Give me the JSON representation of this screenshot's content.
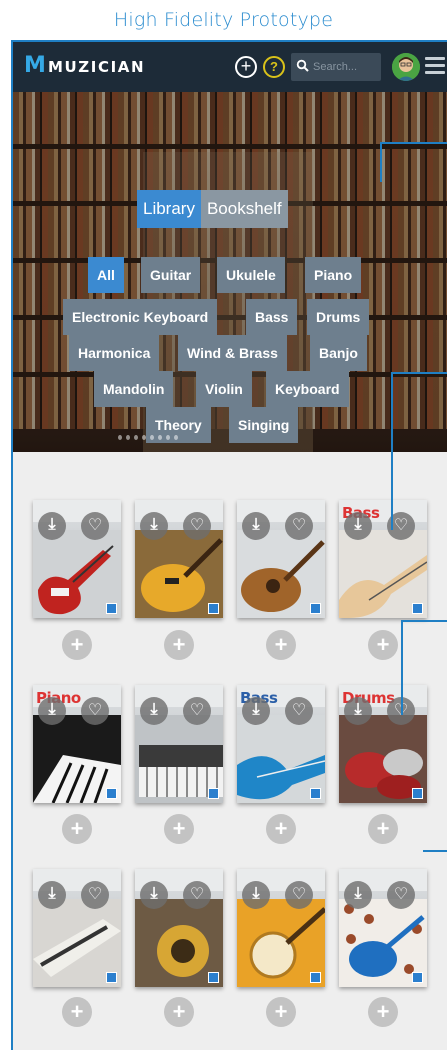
{
  "caption": "High Fidelity Prototype",
  "header": {
    "logo_letter": "M",
    "logo_text": "MUZICIAN",
    "add_symbol": "+",
    "help_symbol": "?",
    "search_placeholder": "Search..."
  },
  "view_toggle": {
    "library": "Library",
    "bookshelf": "Bookshelf",
    "selected": "Library"
  },
  "categories": {
    "all": "All",
    "guitar": "Guitar",
    "ukulele": "Ukulele",
    "piano": "Piano",
    "electronic_keyboard": "Electronic Keyboard",
    "bass": "Bass",
    "drums": "Drums",
    "harmonica": "Harmonica",
    "wind_brass": "Wind & Brass",
    "banjo": "Banjo",
    "mandolin": "Mandolin",
    "violin": "Violin",
    "keyboard": "Keyboard",
    "theory": "Theory",
    "singing": "Singing",
    "selected": "All"
  },
  "books": {
    "row1": [
      "",
      "",
      "",
      "Bass"
    ],
    "row2": [
      "Piano",
      "",
      "Bass",
      "Drums"
    ],
    "row3": [
      "",
      "",
      "",
      ""
    ],
    "download_symbol": "⤓",
    "favorite_symbol": "♡",
    "add_symbol": "+"
  },
  "colors": {
    "accent": "#3b8ad1",
    "chip": "#6e7f8e",
    "topbar": "#1d2b38",
    "annotation": "#1f7fc4"
  }
}
